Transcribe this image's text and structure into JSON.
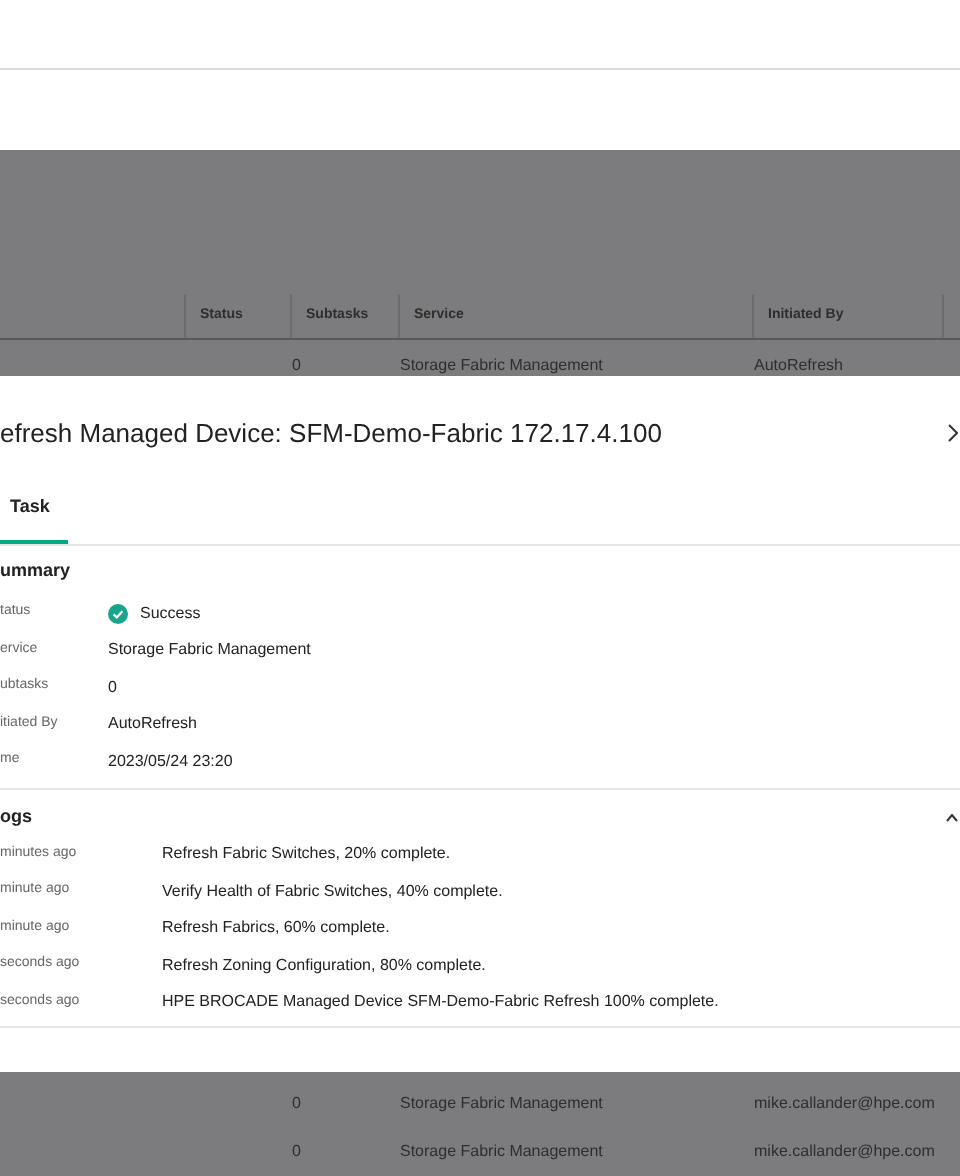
{
  "background_table": {
    "columns": [
      "Status",
      "Subtasks",
      "Service",
      "Initiated By"
    ],
    "rows": [
      {
        "subtasks": "0",
        "service": "Storage Fabric Management",
        "initiated_by": "AutoRefresh"
      }
    ]
  },
  "dialog": {
    "title": "efresh Managed Device: SFM-Demo-Fabric 172.17.4.100",
    "tabs": [
      {
        "label": "Task",
        "selected": true
      }
    ],
    "summary": {
      "heading": "ummary",
      "fields": [
        {
          "label": "tatus",
          "value": "Success",
          "kind": "status"
        },
        {
          "label": "ervice",
          "value": "Storage Fabric Management",
          "kind": "text"
        },
        {
          "label": "ubtasks",
          "value": "0",
          "kind": "text"
        },
        {
          "label": "itiated By",
          "value": "AutoRefresh",
          "kind": "text"
        },
        {
          "label": "me",
          "value": "2023/05/24 23:20",
          "kind": "text"
        }
      ]
    },
    "logs": {
      "heading": "ogs",
      "expanded": true,
      "entries": [
        {
          "time": "minutes ago",
          "message": "Refresh Fabric Switches, 20% complete."
        },
        {
          "time": "minute ago",
          "message": "Verify Health of Fabric Switches, 40% complete."
        },
        {
          "time": "minute ago",
          "message": "Refresh Fabrics, 60% complete."
        },
        {
          "time": "seconds ago",
          "message": "Refresh Zoning Configuration, 80% complete."
        },
        {
          "time": "seconds ago",
          "message": "HPE BROCADE Managed Device SFM-Demo-Fabric Refresh 100% complete."
        }
      ]
    }
  },
  "background_rows_below": [
    {
      "subtasks": "0",
      "service": "Storage Fabric Management",
      "initiated_by": "mike.callander@hpe.com"
    },
    {
      "subtasks": "0",
      "service": "Storage Fabric Management",
      "initiated_by": "mike.callander@hpe.com"
    }
  ]
}
